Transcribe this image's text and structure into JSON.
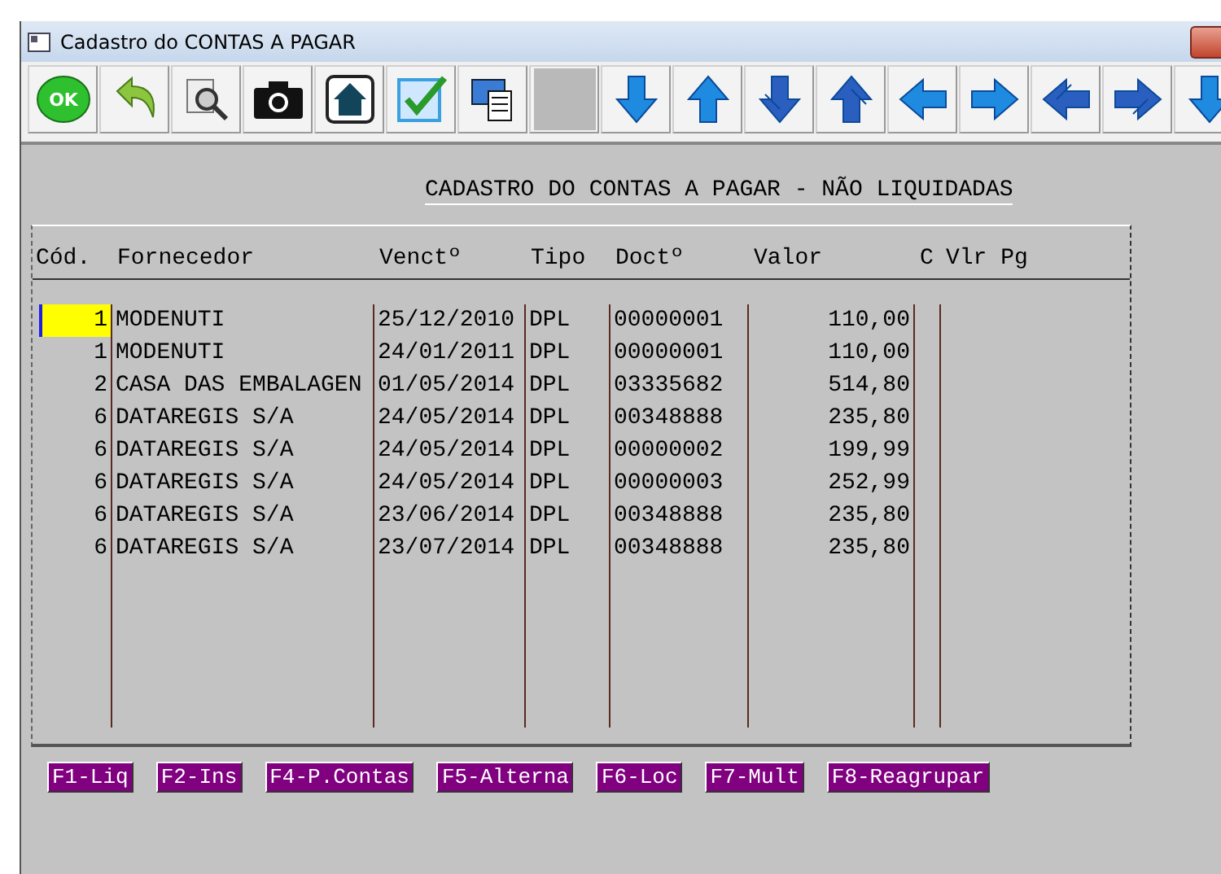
{
  "window": {
    "title": "Cadastro do CONTAS A PAGAR"
  },
  "toolbar": [
    {
      "kind": "ok",
      "label": "OK"
    },
    {
      "kind": "undo"
    },
    {
      "kind": "search"
    },
    {
      "kind": "camera"
    },
    {
      "kind": "home"
    },
    {
      "kind": "check"
    },
    {
      "kind": "computer"
    },
    {
      "kind": "blank"
    },
    {
      "kind": "down"
    },
    {
      "kind": "up"
    },
    {
      "kind": "down2"
    },
    {
      "kind": "up2"
    },
    {
      "kind": "left"
    },
    {
      "kind": "right"
    },
    {
      "kind": "left2"
    },
    {
      "kind": "right2"
    },
    {
      "kind": "down"
    }
  ],
  "heading": "CADASTRO DO CONTAS A PAGAR - NÃO LIQUIDADAS",
  "table": {
    "columns": [
      "Cód.",
      "Fornecedor",
      "Venctº",
      "Tipo",
      "Doctº",
      "Valor",
      "C",
      "Vlr Pg"
    ],
    "rows": [
      {
        "selected": true,
        "cells": [
          "1",
          "MODENUTI",
          "25/12/2010",
          "DPL",
          "00000001",
          "110,00"
        ]
      },
      {
        "selected": false,
        "cells": [
          "1",
          "MODENUTI",
          "24/01/2011",
          "DPL",
          "00000001",
          "110,00"
        ]
      },
      {
        "selected": false,
        "cells": [
          "2",
          "CASA DAS EMBALAGEN",
          "01/05/2014",
          "DPL",
          "03335682",
          "514,80"
        ]
      },
      {
        "selected": false,
        "cells": [
          "6",
          "DATAREGIS S/A",
          "24/05/2014",
          "DPL",
          "00348888",
          "235,80"
        ]
      },
      {
        "selected": false,
        "cells": [
          "6",
          "DATAREGIS S/A",
          "24/05/2014",
          "DPL",
          "00000002",
          "199,99"
        ]
      },
      {
        "selected": false,
        "cells": [
          "6",
          "DATAREGIS S/A",
          "24/05/2014",
          "DPL",
          "00000003",
          "252,99"
        ]
      },
      {
        "selected": false,
        "cells": [
          "6",
          "DATAREGIS S/A",
          "23/06/2014",
          "DPL",
          "00348888",
          "235,80"
        ]
      },
      {
        "selected": false,
        "cells": [
          "6",
          "DATAREGIS S/A",
          "23/07/2014",
          "DPL",
          "00348888",
          "235,80"
        ]
      }
    ]
  },
  "function_keys": [
    "F1-Liq",
    "F2-Ins",
    "F4-P.Contas",
    "F5-Alterna",
    "F6-Loc",
    "F7-Mult",
    "F8-Reagrupar"
  ]
}
